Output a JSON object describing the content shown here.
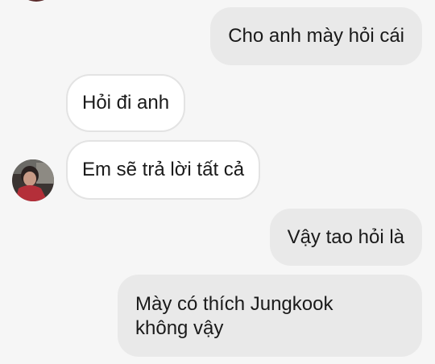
{
  "messages": [
    {
      "sender": "me",
      "text": "Cho anh mày hỏi cái"
    },
    {
      "sender": "other",
      "text": "Hỏi đi anh"
    },
    {
      "sender": "other",
      "text": "Em sẽ trả lời tất cả"
    },
    {
      "sender": "me",
      "text": "Vậy tao hỏi là"
    },
    {
      "sender": "me",
      "text_line1": "Mày có thích Jungkook",
      "text_line2": "không vậy"
    }
  ],
  "colors": {
    "background": "#f6f6f6",
    "outgoing_bubble": "#e9e9e9",
    "incoming_bubble": "#ffffff",
    "incoming_border": "#e3e3e3",
    "text": "#1a1a1a"
  }
}
